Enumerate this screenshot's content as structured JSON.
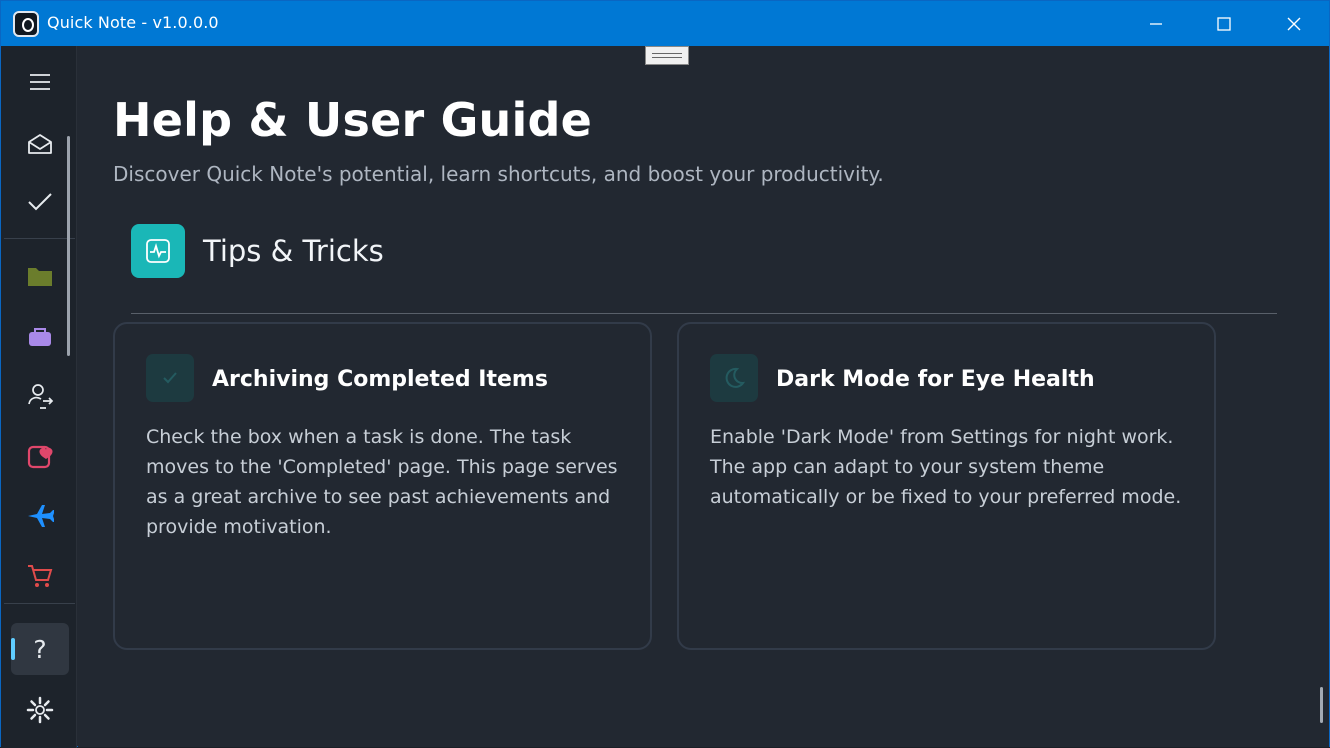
{
  "window": {
    "title": "Quick Note - v1.0.0.0",
    "accent": "#0078d4"
  },
  "sidebar": {
    "items": [
      {
        "name": "menu",
        "icon": "hamburger-icon"
      },
      {
        "name": "inbox",
        "icon": "mail-open-icon"
      },
      {
        "name": "completed",
        "icon": "checkmark-icon"
      },
      {
        "name": "folder",
        "icon": "folder-icon",
        "color": "#6b7d2c"
      },
      {
        "name": "work",
        "icon": "briefcase-icon",
        "color": "#a989e8"
      },
      {
        "name": "shared",
        "icon": "person-sync-icon"
      },
      {
        "name": "health",
        "icon": "calendar-heart-icon",
        "color": "#e0476b"
      },
      {
        "name": "travel",
        "icon": "airplane-icon",
        "color": "#1e90ff"
      },
      {
        "name": "shopping",
        "icon": "cart-icon",
        "color": "#e04b4b"
      },
      {
        "name": "help",
        "icon": "question-icon",
        "label": "?"
      },
      {
        "name": "settings",
        "icon": "gear-icon"
      }
    ]
  },
  "page": {
    "title": "Help & User Guide",
    "subtitle": "Discover Quick Note's potential, learn shortcuts, and boost your productivity.",
    "section": {
      "title": "Tips & Tricks",
      "icon": "pulse-chart-icon"
    },
    "cards": [
      {
        "title": "Archiving Completed Items",
        "body": "Check the box when a task is done. The task moves to the 'Completed' page. This page serves as a great archive to see past achievements and provide motivation.",
        "icon": "checkmark-icon"
      },
      {
        "title": "Dark Mode for Eye Health",
        "body": "Enable 'Dark Mode' from Settings for night work. The app can adapt to your system theme automatically or be fixed to your preferred mode.",
        "icon": "moon-icon"
      }
    ]
  }
}
